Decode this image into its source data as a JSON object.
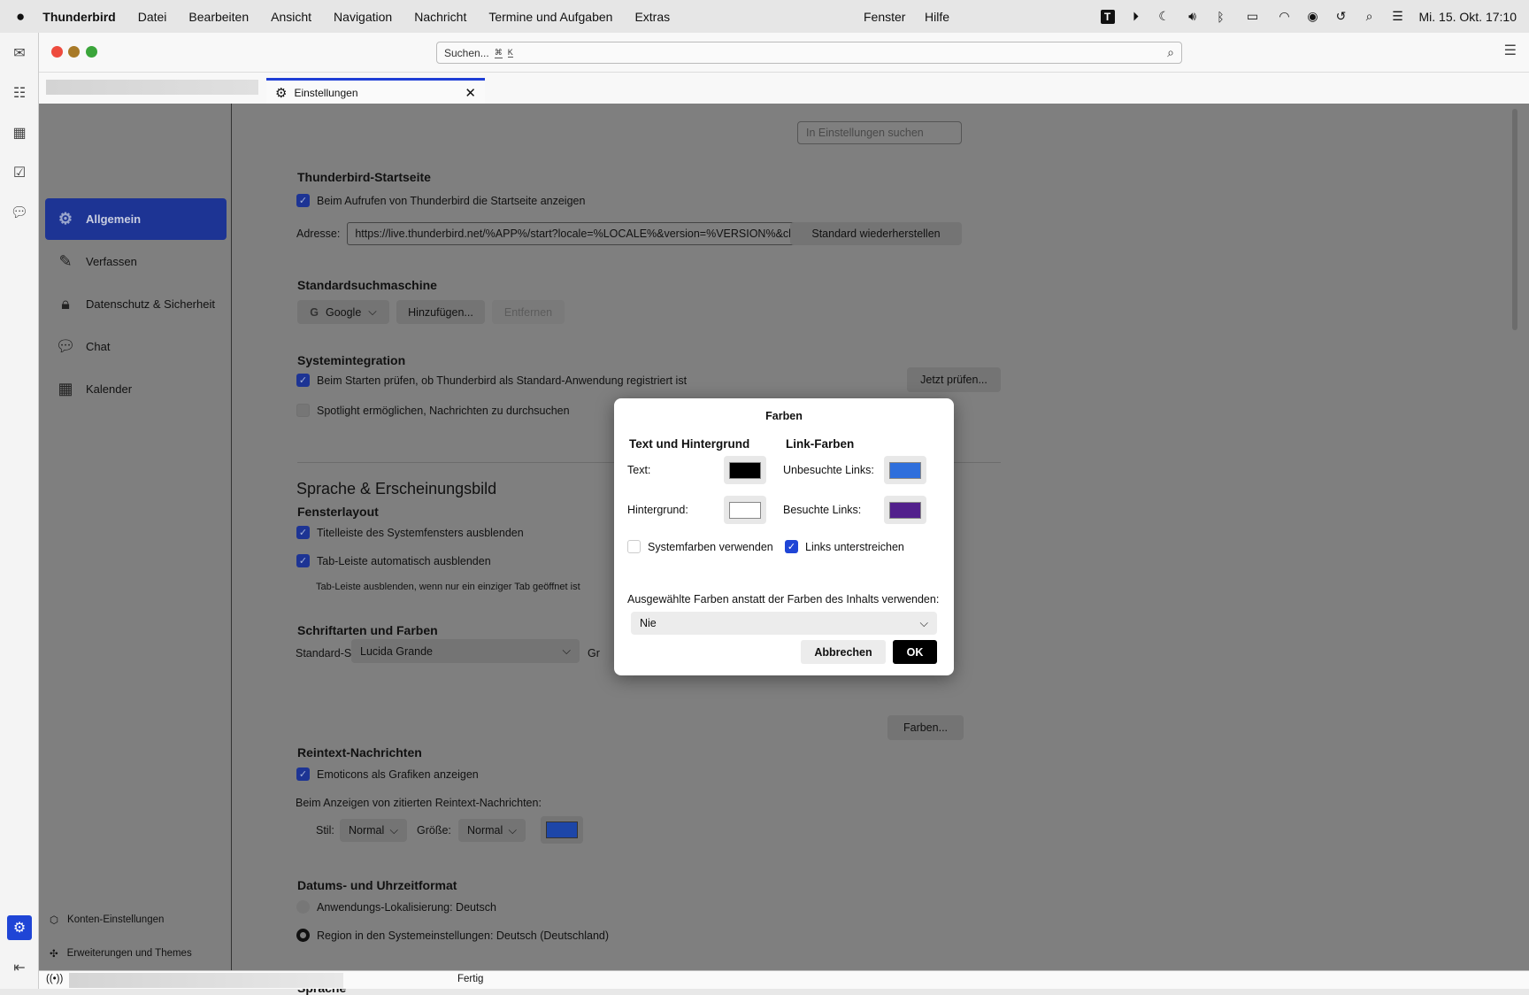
{
  "menubar": {
    "app": "Thunderbird",
    "items": [
      "Datei",
      "Bearbeiten",
      "Ansicht",
      "Navigation",
      "Nachricht",
      "Termine und Aufgaben",
      "Extras",
      "Fenster",
      "Hilfe"
    ],
    "clock": "Mi. 15. Okt.  17:10"
  },
  "toolbar": {
    "search_placeholder": "Suchen...",
    "shortcut1": "⌘",
    "shortcut2": "K"
  },
  "tab": {
    "label": "Einstellungen"
  },
  "nav": {
    "items": [
      {
        "label": "Allgemein"
      },
      {
        "label": "Verfassen"
      },
      {
        "label": "Datenschutz & Sicherheit"
      },
      {
        "label": "Chat"
      },
      {
        "label": "Kalender"
      }
    ],
    "accounts": "Konten-Einstellungen",
    "addons": "Erweiterungen und Themes"
  },
  "settings": {
    "search_placeholder": "In Einstellungen suchen",
    "startpage_title": "Thunderbird-Startseite",
    "startpage_cb": "Beim Aufrufen von Thunderbird die Startseite anzeigen",
    "address_label": "Adresse:",
    "address_value": "https://live.thunderbird.net/%APP%/start?locale=%LOCALE%&version=%VERSION%&channel=",
    "restore_default": "Standard wiederherstellen",
    "search_engine_title": "Standardsuchmaschine",
    "engine": "Google",
    "add": "Hinzufügen...",
    "remove": "Entfernen",
    "sysint_title": "Systemintegration",
    "sysint_cb": "Beim Starten prüfen, ob Thunderbird als Standard-Anwendung registriert ist",
    "check_now": "Jetzt prüfen...",
    "spotlight_cb": "Spotlight ermöglichen, Nachrichten zu durchsuchen",
    "lang_section": "Sprache & Erscheinungsbild",
    "window_layout": "Fensterlayout",
    "hide_titlebar": "Titelleiste des Systemfensters ausblenden",
    "autohide_tabs": "Tab-Leiste automatisch ausblenden",
    "autohide_desc": "Tab-Leiste ausblenden, wenn nur ein einziger Tab geöffnet ist",
    "fonts_title": "Schriftarten und Farben",
    "default_font_label": "Standard-Schriftart:",
    "default_font": "Lucida Grande",
    "size_label_partial": "Gr",
    "colors_button": "Farben...",
    "plaintext_title": "Reintext-Nachrichten",
    "emoticons_cb": "Emoticons als Grafiken anzeigen",
    "quoted_label": "Beim Anzeigen von zitierten Reintext-Nachrichten:",
    "style_label": "Stil:",
    "style_value": "Normal",
    "size_label": "Größe:",
    "size_value": "Normal",
    "quote_color": "#1d46a8",
    "datetime_title": "Datums- und Uhrzeitformat",
    "app_locale": "Anwendungs-Lokalisierung: Deutsch",
    "region_locale": "Region in den Systemeinstellungen: Deutsch (Deutschland)",
    "language_title": "Sprache"
  },
  "dialog": {
    "title": "Farben",
    "col1": "Text und Hintergrund",
    "col2": "Link-Farben",
    "text_label": "Text:",
    "bg_label": "Hintergrund:",
    "unvisited_label": "Unbesuchte Links:",
    "visited_label": "Besuchte Links:",
    "colors": {
      "text": "#000000",
      "background": "#ffffff",
      "unvisited": "#2f6fdc",
      "visited": "#52208c"
    },
    "system_colors": "Systemfarben verwenden",
    "underline_links": "Links unterstreichen",
    "override_label": "Ausgewählte Farben anstatt der Farben des Inhalts verwenden:",
    "override_value": "Nie",
    "cancel": "Abbrechen",
    "ok": "OK"
  },
  "status": {
    "text": "Fertig"
  }
}
